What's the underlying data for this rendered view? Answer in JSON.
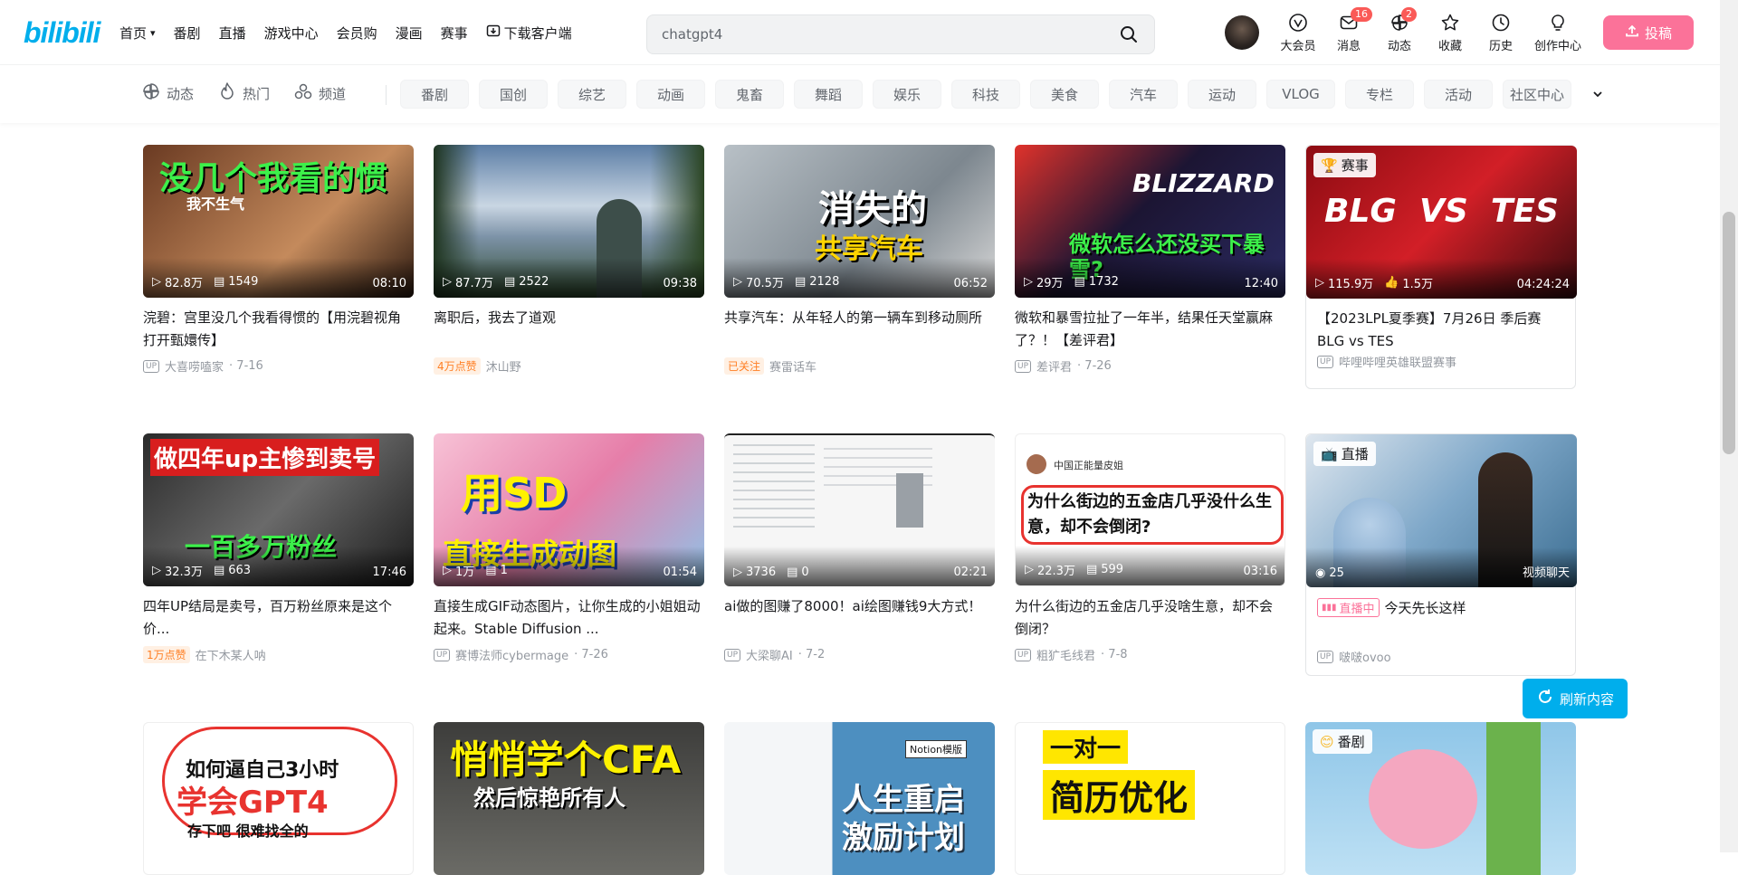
{
  "header": {
    "logo": "bilibili",
    "nav": [
      "首页",
      "番剧",
      "直播",
      "游戏中心",
      "会员购",
      "漫画",
      "赛事",
      "下载客户端"
    ],
    "search_value": "chatgpt4",
    "right": [
      {
        "label": "大会员",
        "icon": "vip-icon"
      },
      {
        "label": "消息",
        "icon": "message-icon",
        "badge": "16"
      },
      {
        "label": "动态",
        "icon": "dynamic-icon",
        "badge": "2"
      },
      {
        "label": "收藏",
        "icon": "star-icon"
      },
      {
        "label": "历史",
        "icon": "history-icon"
      },
      {
        "label": "创作中心",
        "icon": "creator-icon"
      }
    ],
    "upload": "投稿"
  },
  "channels": {
    "main": [
      "动态",
      "热门",
      "频道"
    ],
    "pills": [
      "番剧",
      "国创",
      "综艺",
      "动画",
      "鬼畜",
      "舞蹈",
      "娱乐",
      "科技",
      "美食",
      "汽车",
      "运动",
      "VLOG",
      "专栏",
      "活动",
      "社区中心"
    ]
  },
  "cards": [
    {
      "thumb_text": "没几个我看的惯",
      "thumb_sub": "我不生气",
      "plays": "82.8万",
      "danmaku": "1549",
      "duration": "08:10",
      "title": "浣碧：宫里没几个我看得惯的【用浣碧视角打开甄嬛传】",
      "author": "大喜唠嗑家",
      "date": "· 7-16",
      "bg": "#8a4a2a"
    },
    {
      "thumb_text": "",
      "thumb_sub": "",
      "plays": "87.7万",
      "danmaku": "2522",
      "duration": "09:38",
      "title": "离职后，我去了道观",
      "badge": "4万点赞",
      "author": "沐山野",
      "date": "",
      "bg": "#6f8fae"
    },
    {
      "thumb_text": "消失的",
      "thumb_sub": "共享汽车",
      "plays": "70.5万",
      "danmaku": "2128",
      "duration": "06:52",
      "title": "共享汽车：从年轻人的第一辆车到移动厕所",
      "badge": "已关注",
      "author": "赛雷话车",
      "date": "",
      "bg": "#9aa3ab"
    },
    {
      "thumb_text": "BLIZZARD",
      "thumb_sub": "微软怎么还没买下暴雪?",
      "plays": "29万",
      "danmaku": "1732",
      "duration": "12:40",
      "title": "微软和暴雪拉扯了一年半，结果任天堂赢麻了？！【差评君】",
      "author": "差评君",
      "date": "· 7-26",
      "bg": "#2b1e3a"
    },
    {
      "tag": "赛事",
      "thumb_text": "BLG  VS  TES",
      "thumb_sub": "",
      "plays": "115.9万",
      "likes": "1.5万",
      "duration": "04:24:24",
      "title": "【2023LPL夏季赛】7月26日 季后赛 BLG vs TES",
      "author": "哔哩哔哩英雄联盟赛事",
      "date": "",
      "bg": "#c1121f"
    },
    {
      "thumb_text": "做四年up主惨到卖号",
      "thumb_sub": "一百多万粉丝",
      "plays": "32.3万",
      "danmaku": "663",
      "duration": "17:46",
      "title": "四年UP结局是卖号，百万粉丝原来是这个价...",
      "badge": "1万点赞",
      "author": "在下木某人呐",
      "date": "",
      "bg": "#3a3a3a"
    },
    {
      "thumb_text": "用SD",
      "thumb_sub": "直接生成动图",
      "plays": "1万",
      "danmaku": "1",
      "duration": "01:54",
      "title": "直接生成GIF动态图片，让你生成的小姐姐动起来。Stable Diffusion ...",
      "author": "赛博法师cybermage",
      "date": "· 7-26",
      "bg": "#e58fb2"
    },
    {
      "thumb_text": "",
      "thumb_sub": "",
      "plays": "3736",
      "danmaku": "0",
      "duration": "02:21",
      "title": "ai做的图赚了8000！ai绘图赚钱9大方式！",
      "author": "大梁聊AI",
      "date": "· 7-2",
      "bg": "#f4f4f4"
    },
    {
      "thumb_text": "为什么街边的五金店几乎没什么生意，却不会倒闭?",
      "thumb_sub": "中国正能量皮姐",
      "plays": "22.3万",
      "danmaku": "599",
      "duration": "03:16",
      "title": "为什么街边的五金店几乎没啥生意，却不会倒闭？",
      "author": "粗犷毛线君",
      "date": "· 7-8",
      "bg": "#ffffff"
    },
    {
      "tag": "直播",
      "thumb_text": "",
      "thumb_sub": "",
      "plays": "25",
      "duration": "视频聊天",
      "title": "今天先长这样",
      "live": "直播中",
      "author": "啵啵ovoo",
      "date": "",
      "bg": "#7fa8c9"
    },
    {
      "thumb_text": "如何逼自己3小时",
      "thumb_sub": "学会GPT4",
      "thumb_sub2": "存下吧 很难找全的",
      "bg": "#ffffff"
    },
    {
      "thumb_text": "悄悄学个CFA",
      "thumb_sub": "然后惊艳所有人",
      "bg": "#4a4a48"
    },
    {
      "thumb_text": "人生重启",
      "thumb_sub": "激励计划",
      "notion": "Notion模版",
      "bg": "#4d8fc0"
    },
    {
      "thumb_text": "一对一",
      "thumb_sub": "简历优化",
      "bg": "#ffffff"
    },
    {
      "tag": "番剧",
      "thumb_text": "",
      "thumb_sub": "",
      "bg": "#8fc6e8"
    }
  ],
  "refresh": "刷新内容"
}
